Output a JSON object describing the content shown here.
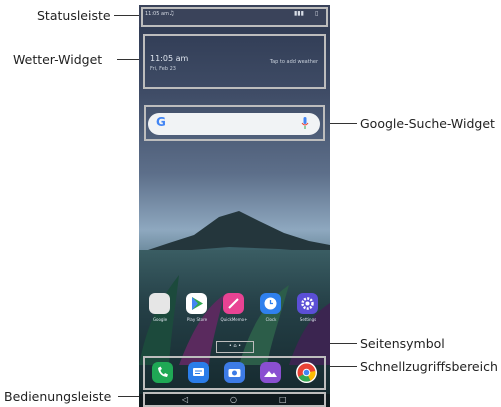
{
  "callouts": {
    "statusbar": "Statusleiste",
    "weather": "Wetter-Widget",
    "search": "Google-Suche-Widget",
    "page_icon": "Seitensymbol",
    "quick_access": "Schnellzugriffsbereich",
    "navigation": "Bedienungsleiste"
  },
  "screen": {
    "status_time": "11:05 am",
    "weather_time": "11:05 am",
    "weather_date": "Fri, Feb 23",
    "weather_hint": "Tap to add weather",
    "search_logo": "G",
    "home_apps": [
      {
        "label": "Google",
        "icon": "folder-icon",
        "color": "#e6e6e6"
      },
      {
        "label": "Play Store",
        "icon": "play-store-icon",
        "color": "#ffffff"
      },
      {
        "label": "QuickMemo+",
        "icon": "pen-icon",
        "color": "#e84393"
      },
      {
        "label": "Clock",
        "icon": "clock-icon",
        "color": "#2f80ed"
      },
      {
        "label": "Settings",
        "icon": "gear-icon",
        "color": "#5b4fd6"
      }
    ],
    "dock_apps": [
      {
        "icon": "phone-icon",
        "color": "#1fa855"
      },
      {
        "icon": "messages-icon",
        "color": "#2b7de9"
      },
      {
        "icon": "camera-icon",
        "color": "#3d7be6"
      },
      {
        "icon": "gallery-icon",
        "color": "#8a4fd1"
      },
      {
        "icon": "chrome-icon",
        "color": "#ffffff"
      }
    ],
    "page_dots": "• ⌂ •",
    "nav_back": "◁",
    "nav_home": "○",
    "nav_recent": "□"
  }
}
